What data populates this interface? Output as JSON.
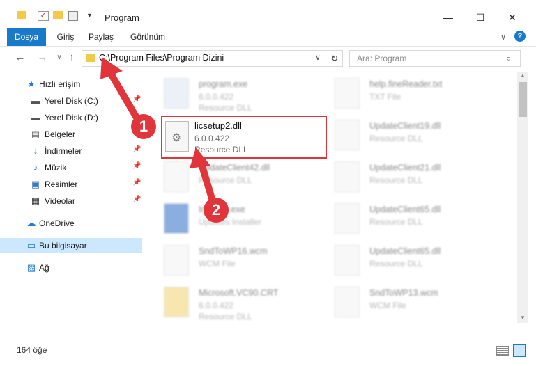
{
  "window": {
    "title": "Program",
    "minimize": "—",
    "maximize": "☐",
    "close": "✕"
  },
  "ribbon": {
    "tabs": [
      "Dosya",
      "Giriş",
      "Paylaş",
      "Görünüm"
    ],
    "expand": "∨",
    "help": "?"
  },
  "nav": {
    "back": "←",
    "forward": "→",
    "recent": "∨",
    "up": "↑",
    "address": "C:\\Program Files\\Program Dizini",
    "dropdown": "∨",
    "refresh": "↻",
    "search_placeholder": "Ara: Program"
  },
  "sidebar": {
    "items": [
      {
        "label": "Hızlı erişim",
        "icon": "star-icon",
        "glyph": "★",
        "color": "#1e7bd6"
      },
      {
        "label": "Yerel Disk (C:)",
        "icon": "drive-icon",
        "glyph": "▬",
        "color": "#555"
      },
      {
        "label": "Yerel Disk (D:)",
        "icon": "drive-icon",
        "glyph": "▬",
        "color": "#555"
      },
      {
        "label": "Belgeler",
        "icon": "documents-icon",
        "glyph": "▤",
        "color": "#666"
      },
      {
        "label": "İndirmeler",
        "icon": "download-icon",
        "glyph": "↓",
        "color": "#1e7bd6"
      },
      {
        "label": "Müzik",
        "icon": "music-icon",
        "glyph": "♪",
        "color": "#1e7bd6"
      },
      {
        "label": "Resimler",
        "icon": "pictures-icon",
        "glyph": "▣",
        "color": "#3a77c4"
      },
      {
        "label": "Videolar",
        "icon": "video-icon",
        "glyph": "▦",
        "color": "#333"
      },
      {
        "label": "OneDrive",
        "icon": "cloud-icon",
        "glyph": "☁",
        "color": "#1e7bd6"
      },
      {
        "label": "Bu bilgisayar",
        "icon": "computer-icon",
        "glyph": "▭",
        "color": "#1e7bd6"
      },
      {
        "label": "Ağ",
        "icon": "network-icon",
        "glyph": "▨",
        "color": "#1e7bd6"
      }
    ],
    "pin": "📌"
  },
  "files": {
    "highlighted": {
      "name": "licsetup2.dll",
      "version": "6.0.0.422",
      "type": "Resource DLL"
    },
    "blurred": [
      {
        "name": "program.exe",
        "meta": "6.0.0.422",
        "meta2": "Resource DLL"
      },
      {
        "name": "help.fineReader.txt",
        "meta": "TXT File",
        "meta2": ""
      },
      {
        "name": "UpdateClient19.dll",
        "meta": "Resource DLL",
        "meta2": ""
      },
      {
        "name": "UpdateClient42.dll",
        "meta": "Resource DLL",
        "meta2": ""
      },
      {
        "name": "UpdateClient21.dll",
        "meta": "Resource DLL",
        "meta2": ""
      },
      {
        "name": "Installer.exe",
        "meta": "Updates Installer",
        "meta2": ""
      },
      {
        "name": "UpdateClient65.dll",
        "meta": "Resource DLL",
        "meta2": ""
      },
      {
        "name": "SndToWP16.wcm",
        "meta": "WCM File",
        "meta2": ""
      },
      {
        "name": "UpdateClient65.dll",
        "meta": "Resource DLL",
        "meta2": ""
      },
      {
        "name": "Microsoft.VC90.CRT",
        "meta": "6.0.0.422",
        "meta2": "Resource DLL"
      },
      {
        "name": "SndToWP13.wcm",
        "meta": "WCM File",
        "meta2": ""
      }
    ]
  },
  "status": {
    "count": "164 öğe"
  },
  "annotations": {
    "step1": "1",
    "step2": "2",
    "color": "#e0353a"
  }
}
